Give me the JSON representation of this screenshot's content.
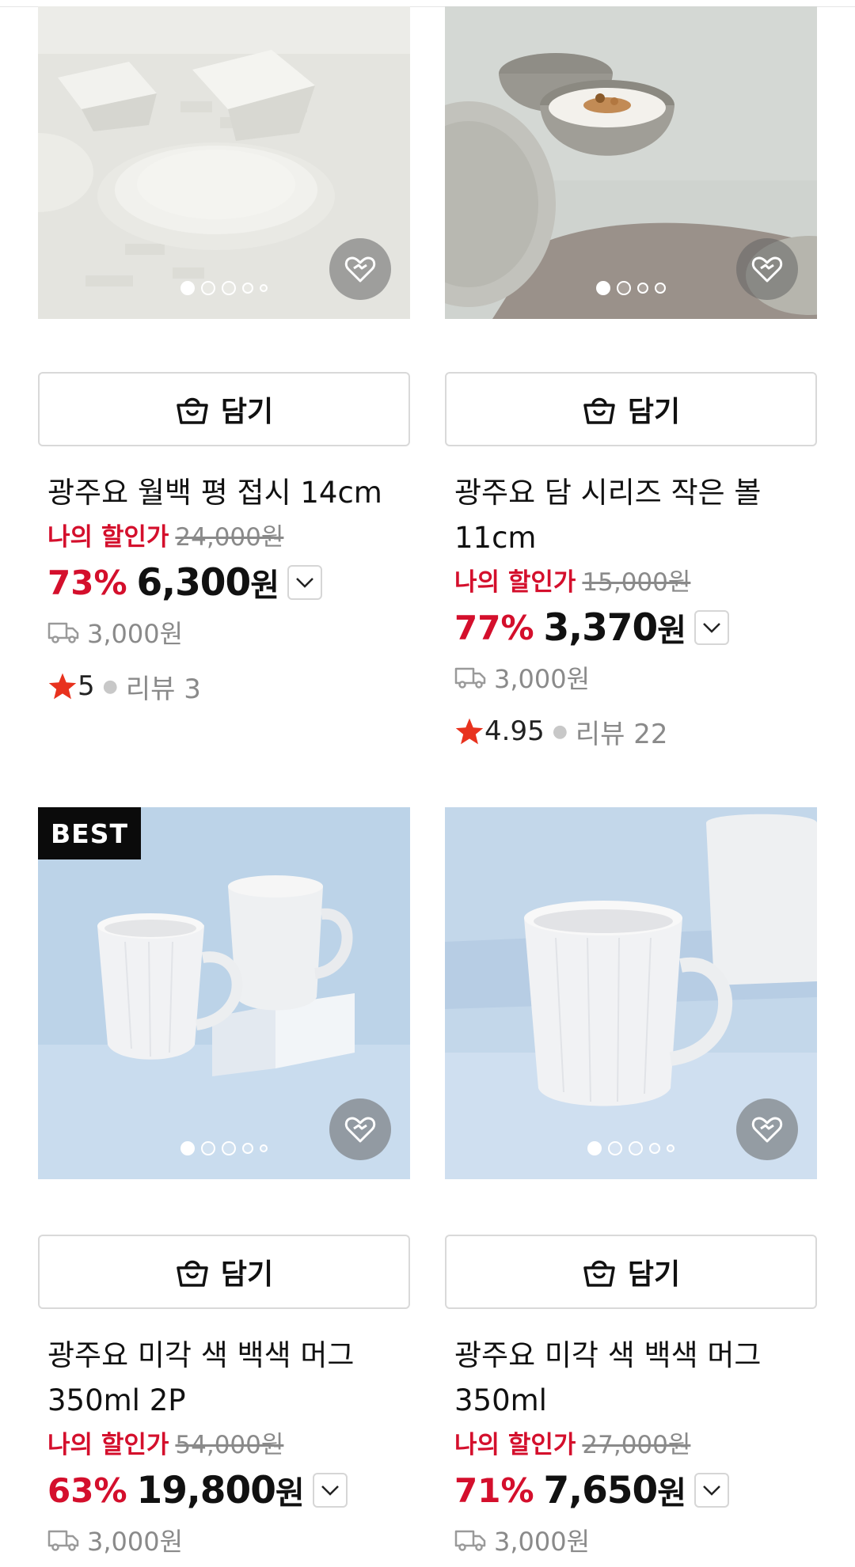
{
  "colors": {
    "discount": "#d40f2c",
    "muted": "#8a8a8a",
    "star": "#e8321e"
  },
  "cart_label": "담기",
  "products": [
    {
      "title": "광주요 월백 평 접시 14cm",
      "discount_label": "나의 할인가",
      "original_price": "24,000원",
      "discount_pct": "73%",
      "price": "6,300",
      "currency": "원",
      "shipping": "3,000원",
      "rating": "5",
      "reviews": "리뷰 3",
      "badge": "",
      "carousel": {
        "count": 5,
        "active": 0
      },
      "image_desc": "white plates and bowls on table"
    },
    {
      "title": "광주요 담 시리즈 작은 볼 11cm",
      "discount_label": "나의 할인가",
      "original_price": "15,000원",
      "discount_pct": "77%",
      "price": "3,370",
      "currency": "원",
      "shipping": "3,000원",
      "rating": "4.95",
      "reviews": "리뷰 22",
      "badge": "",
      "carousel": {
        "count": 4,
        "active": 0
      },
      "image_desc": "grey bowls with granola"
    },
    {
      "title": "광주요 미각 색 백색 머그 350ml 2P",
      "discount_label": "나의 할인가",
      "original_price": "54,000원",
      "discount_pct": "63%",
      "price": "19,800",
      "currency": "원",
      "shipping": "3,000원",
      "badge": "BEST",
      "carousel": {
        "count": 5,
        "active": 0
      },
      "image_desc": "two white mugs on light blue"
    },
    {
      "title": "광주요 미각 색 백색 머그 350ml",
      "discount_label": "나의 할인가",
      "original_price": "27,000원",
      "discount_pct": "71%",
      "price": "7,650",
      "currency": "원",
      "shipping": "3,000원",
      "badge": "",
      "carousel": {
        "count": 5,
        "active": 0
      },
      "image_desc": "white mug on light blue"
    }
  ]
}
